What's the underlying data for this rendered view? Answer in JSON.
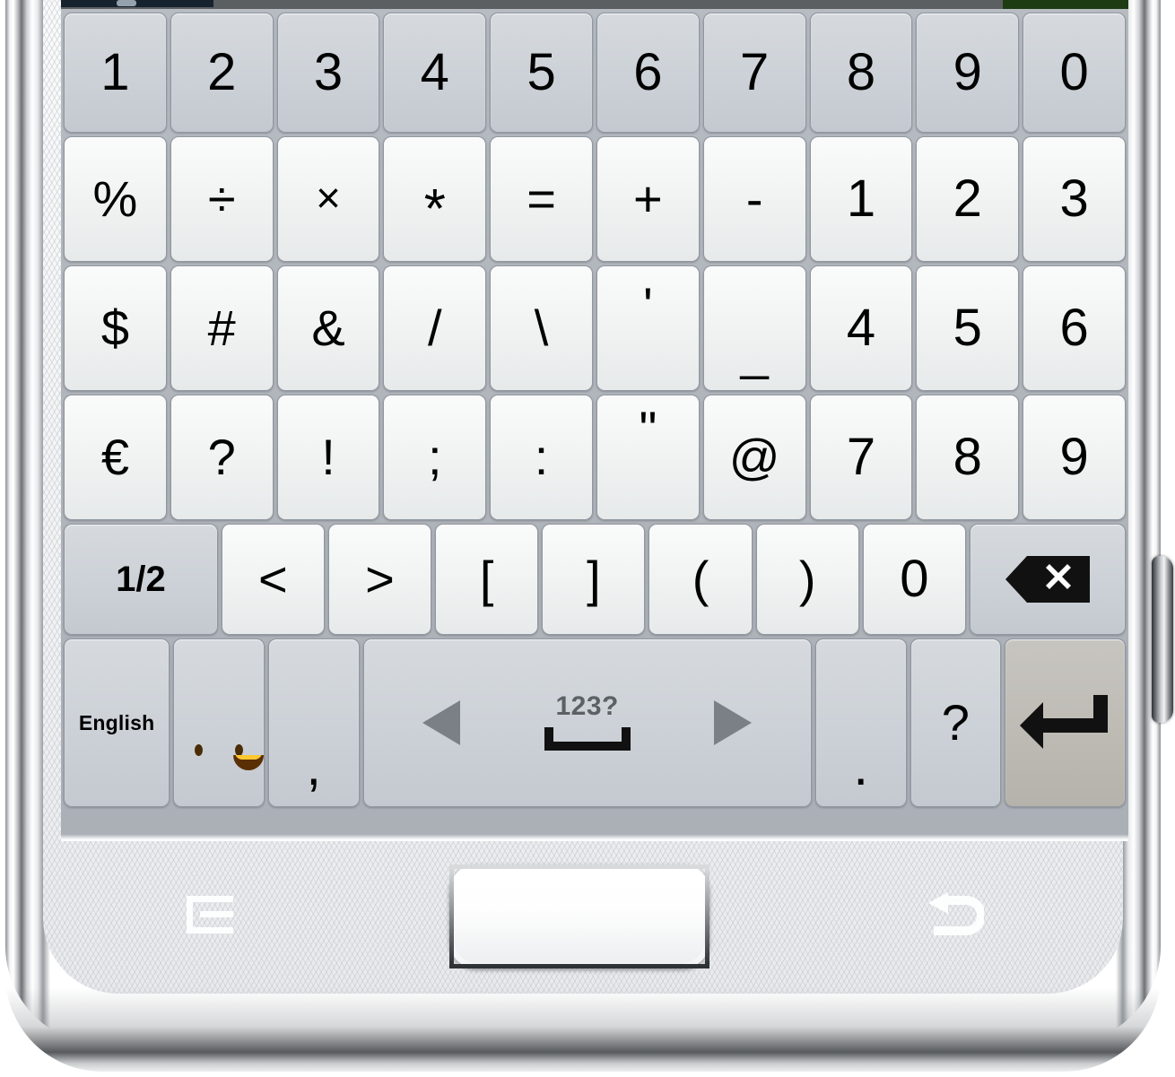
{
  "device": {
    "name": "smartphone-frame",
    "home_button": "home-button",
    "menu_key": "menu-softkey",
    "back_key": "back-softkey",
    "power_button": "power-button"
  },
  "app_strip": {
    "visible": true,
    "colors": {
      "bar": "#5c5f61",
      "dark_left": "#16222e",
      "green_right": "#1d3c14"
    }
  },
  "keyboard": {
    "name": "samsung-symbols-keyboard",
    "page_indicator": "1/2",
    "language_label": "English",
    "space_label": "123?",
    "colors": {
      "background": "#b2b7bd",
      "key_light": "#f0f2f2",
      "key_function": "#ccd1d7",
      "key_enter": "#bebbb5",
      "key_border": "#9197a0",
      "glyph": "#000000",
      "space_label": "#5c6166",
      "emoji_yellow": "#fdc72f"
    },
    "rows": [
      {
        "name": "row-digits",
        "keys": [
          {
            "label": "1",
            "style": "fn"
          },
          {
            "label": "2",
            "style": "fn"
          },
          {
            "label": "3",
            "style": "fn"
          },
          {
            "label": "4",
            "style": "fn"
          },
          {
            "label": "5",
            "style": "fn"
          },
          {
            "label": "6",
            "style": "fn"
          },
          {
            "label": "7",
            "style": "fn"
          },
          {
            "label": "8",
            "style": "fn"
          },
          {
            "label": "9",
            "style": "fn"
          },
          {
            "label": "0",
            "style": "fn"
          }
        ]
      },
      {
        "name": "row-operators",
        "keys": [
          {
            "label": "%",
            "style": "lt"
          },
          {
            "label": "÷",
            "style": "lt"
          },
          {
            "label": "×",
            "style": "lt"
          },
          {
            "label": "*",
            "style": "lt"
          },
          {
            "label": "=",
            "style": "lt"
          },
          {
            "label": "+",
            "style": "lt"
          },
          {
            "label": "-",
            "style": "lt"
          },
          {
            "label": "1",
            "style": "lt"
          },
          {
            "label": "2",
            "style": "lt"
          },
          {
            "label": "3",
            "style": "lt"
          }
        ]
      },
      {
        "name": "row-symbols-1",
        "keys": [
          {
            "label": "$",
            "style": "lt"
          },
          {
            "label": "#",
            "style": "lt"
          },
          {
            "label": "&",
            "style": "lt"
          },
          {
            "label": "/",
            "style": "lt"
          },
          {
            "label": "\\",
            "style": "lt"
          },
          {
            "label": "'",
            "style": "lt"
          },
          {
            "label": "_",
            "style": "lt"
          },
          {
            "label": "4",
            "style": "lt"
          },
          {
            "label": "5",
            "style": "lt"
          },
          {
            "label": "6",
            "style": "lt"
          }
        ]
      },
      {
        "name": "row-symbols-2",
        "keys": [
          {
            "label": "€",
            "style": "lt"
          },
          {
            "label": "?",
            "style": "lt"
          },
          {
            "label": "!",
            "style": "lt"
          },
          {
            "label": ";",
            "style": "lt"
          },
          {
            "label": ":",
            "style": "lt"
          },
          {
            "label": "\"",
            "style": "lt"
          },
          {
            "label": "@",
            "style": "lt"
          },
          {
            "label": "7",
            "style": "lt"
          },
          {
            "label": "8",
            "style": "lt"
          },
          {
            "label": "9",
            "style": "lt"
          }
        ]
      },
      {
        "name": "row-brackets",
        "keys": [
          {
            "label": "1/2",
            "style": "fn"
          },
          {
            "label": "<",
            "style": "lt"
          },
          {
            "label": ">",
            "style": "lt"
          },
          {
            "label": "[",
            "style": "lt"
          },
          {
            "label": "]",
            "style": "lt"
          },
          {
            "label": "(",
            "style": "lt"
          },
          {
            "label": ")",
            "style": "lt"
          },
          {
            "label": "0",
            "style": "lt"
          },
          {
            "label": "backspace-icon",
            "style": "fn"
          }
        ]
      },
      {
        "name": "row-bottom",
        "keys": [
          {
            "label": "English",
            "style": "fn"
          },
          {
            "label": "emoji-icon",
            "style": "fn"
          },
          {
            "label": ",",
            "style": "fn"
          },
          {
            "label": "123?",
            "style": "fn"
          },
          {
            "label": ".",
            "style": "fn"
          },
          {
            "label": "?",
            "style": "fn"
          },
          {
            "label": "enter-icon",
            "style": "enter"
          }
        ]
      }
    ]
  }
}
